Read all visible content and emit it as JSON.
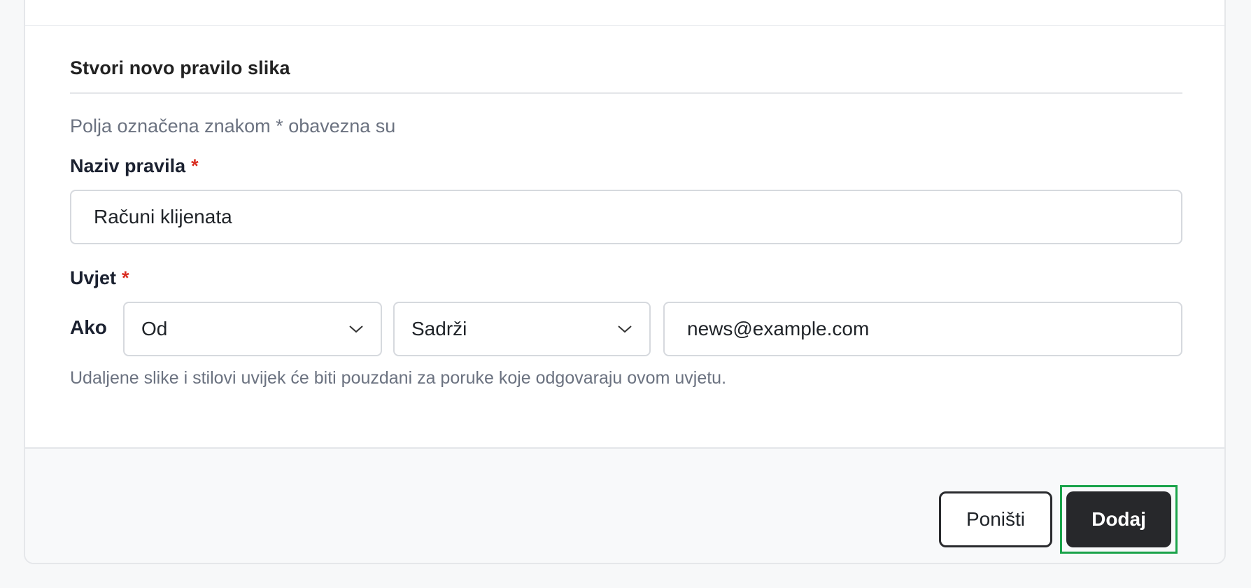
{
  "form": {
    "title": "Stvori novo pravilo slika",
    "required_hint": "Polja označena znakom * obavezna su",
    "name_field": {
      "label": "Naziv pravila",
      "required_mark": "*",
      "value": "Računi klijenata"
    },
    "condition": {
      "label": "Uvjet",
      "required_mark": "*",
      "prefix": "Ako",
      "field_select": {
        "selected": "Od"
      },
      "operator_select": {
        "selected": "Sadrži"
      },
      "value": "news@example.com",
      "helper_text": "Udaljene slike i stilovi uvijek će biti pouzdani za poruke koje odgovaraju ovom uvjetu."
    }
  },
  "footer": {
    "cancel_label": "Poništi",
    "add_label": "Dodaj"
  },
  "colors": {
    "required": "#d92d20",
    "primary_button": "#27282b",
    "focus_ring": "#1aa34a",
    "muted_text": "#6b7280"
  }
}
